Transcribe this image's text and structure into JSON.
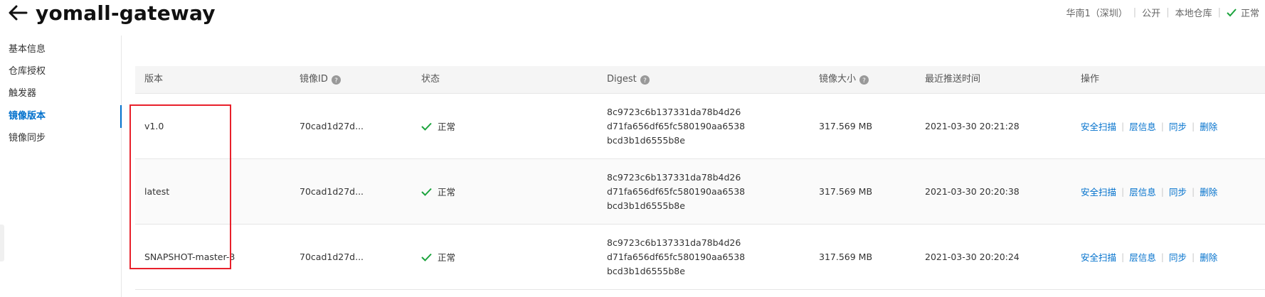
{
  "header": {
    "title": "yomall-gateway",
    "meta": {
      "region": "华南1（深圳）",
      "visibility": "公开",
      "repo_type": "本地仓库",
      "status": "正常"
    }
  },
  "sidebar": {
    "items": [
      {
        "label": "基本信息"
      },
      {
        "label": "仓库授权"
      },
      {
        "label": "触发器"
      },
      {
        "label": "镜像版本"
      },
      {
        "label": "镜像同步"
      }
    ],
    "active": "镜像版本"
  },
  "table": {
    "columns": {
      "version": "版本",
      "image_id": "镜像ID",
      "status": "状态",
      "digest": "Digest",
      "size": "镜像大小",
      "pushed": "最近推送时间",
      "ops": "操作"
    },
    "rows": [
      {
        "version": "v1.0",
        "image_id": "70cad1d27d...",
        "status": "正常",
        "digest": [
          "8c9723c6b137331da78b4d26",
          "d71fa656df65fc580190aa6538",
          "bcd3b1d6555b8e"
        ],
        "size": "317.569 MB",
        "pushed": "2021-03-30 20:21:28"
      },
      {
        "version": "latest",
        "image_id": "70cad1d27d...",
        "status": "正常",
        "digest": [
          "8c9723c6b137331da78b4d26",
          "d71fa656df65fc580190aa6538",
          "bcd3b1d6555b8e"
        ],
        "size": "317.569 MB",
        "pushed": "2021-03-30 20:20:38"
      },
      {
        "version": "SNAPSHOT-master-3",
        "image_id": "70cad1d27d...",
        "status": "正常",
        "digest": [
          "8c9723c6b137331da78b4d26",
          "d71fa656df65fc580190aa6538",
          "bcd3b1d6555b8e"
        ],
        "size": "317.569 MB",
        "pushed": "2021-03-30 20:20:24"
      }
    ],
    "actions": {
      "scan": "安全扫描",
      "layers": "层信息",
      "sync": "同步",
      "delete": "删除"
    }
  },
  "colors": {
    "link": "#0070cc",
    "success": "#1aa33c",
    "highlight": "#e8202b"
  }
}
